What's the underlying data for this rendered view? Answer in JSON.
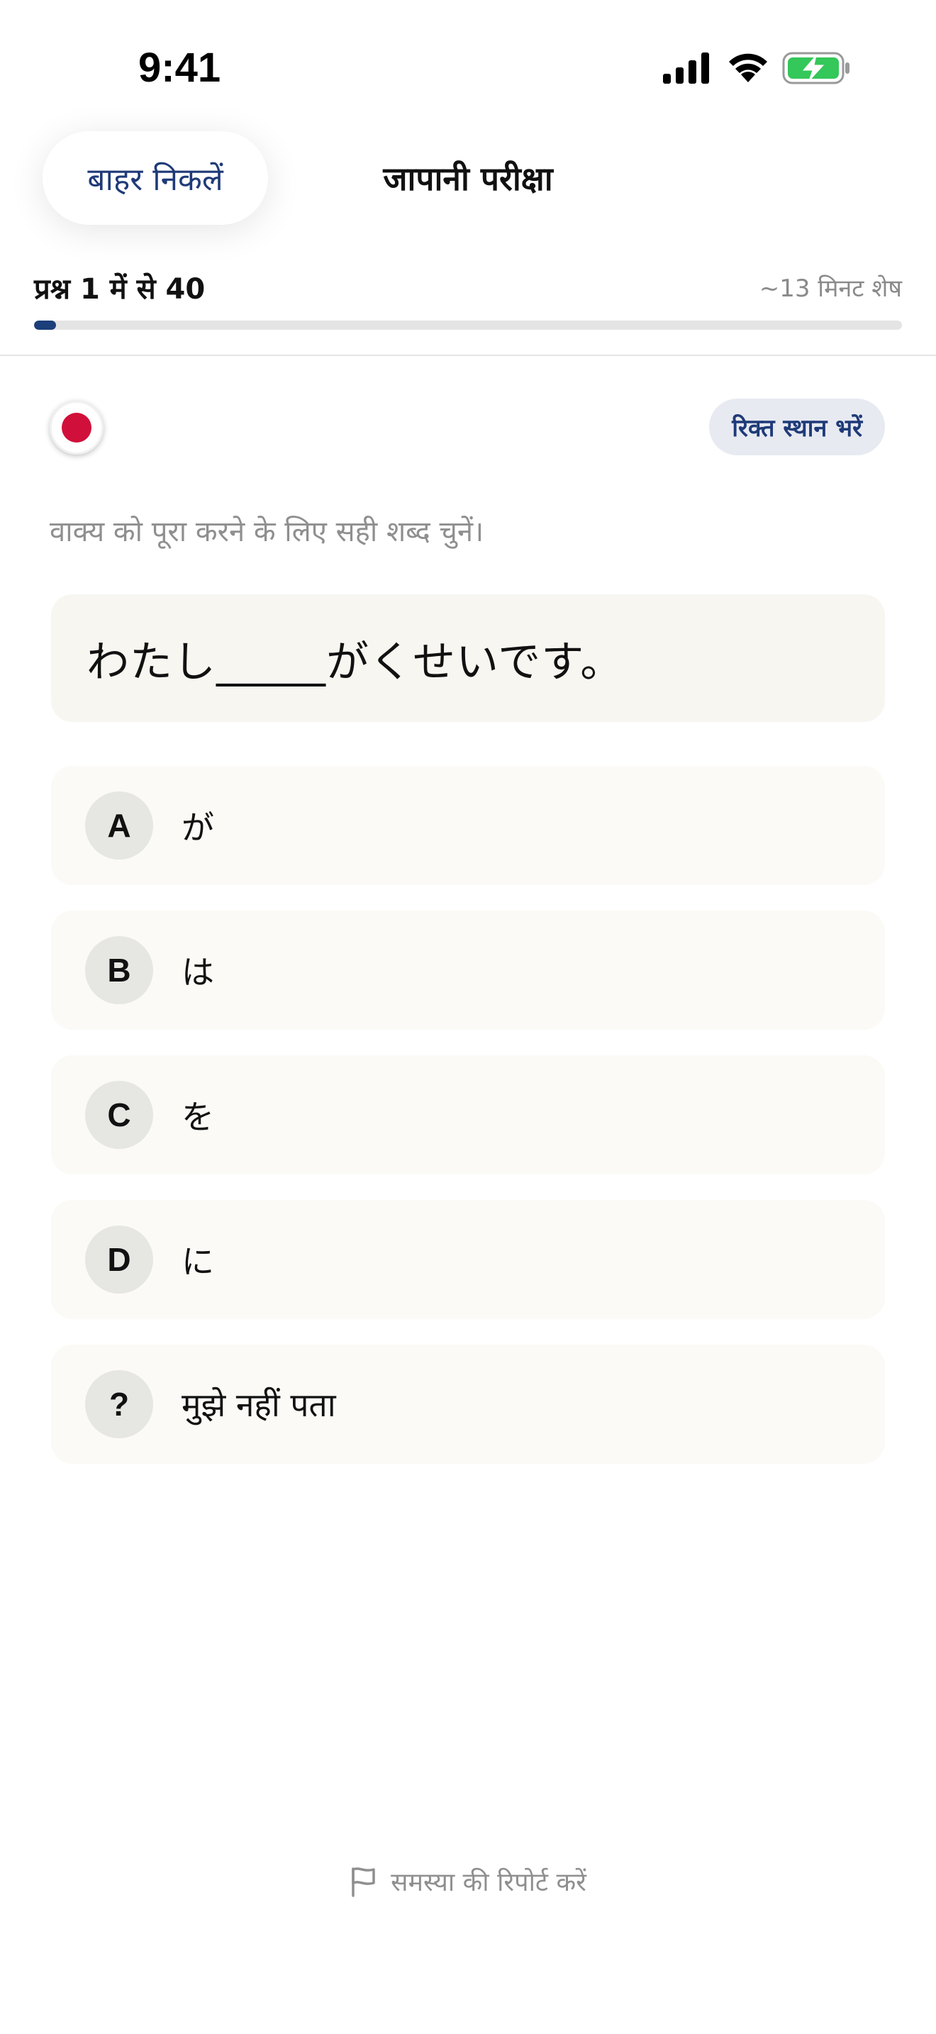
{
  "status_bar": {
    "time": "9:41",
    "icons": [
      "signal-icon",
      "wifi-icon",
      "battery-charging-icon"
    ],
    "battery_color": "#34c759"
  },
  "header": {
    "exit_label": "बाहर निकलें",
    "title": "जापानी परीक्षा"
  },
  "progress": {
    "label": "प्रश्न 1 में से 40",
    "time_remaining": "~13 मिनट शेष",
    "current": 1,
    "total": 40,
    "fill_color": "#1c3e7a"
  },
  "question": {
    "flag_icon": "japan-flag-icon",
    "flag_color": "#d0103a",
    "type_badge": "रिक्त स्थान भरें",
    "instruction": "वाक्य को पूरा करने के लिए सही शब्द चुनें।",
    "text": "わたし_____がくせいです。"
  },
  "options": [
    {
      "letter": "A",
      "text": "が"
    },
    {
      "letter": "B",
      "text": "は"
    },
    {
      "letter": "C",
      "text": "を"
    },
    {
      "letter": "D",
      "text": "に"
    },
    {
      "letter": "?",
      "text": "मुझे नहीं पता"
    }
  ],
  "footer": {
    "report_icon": "flag-outline-icon",
    "report_label": "समस्या की रिपोर्ट करें"
  }
}
